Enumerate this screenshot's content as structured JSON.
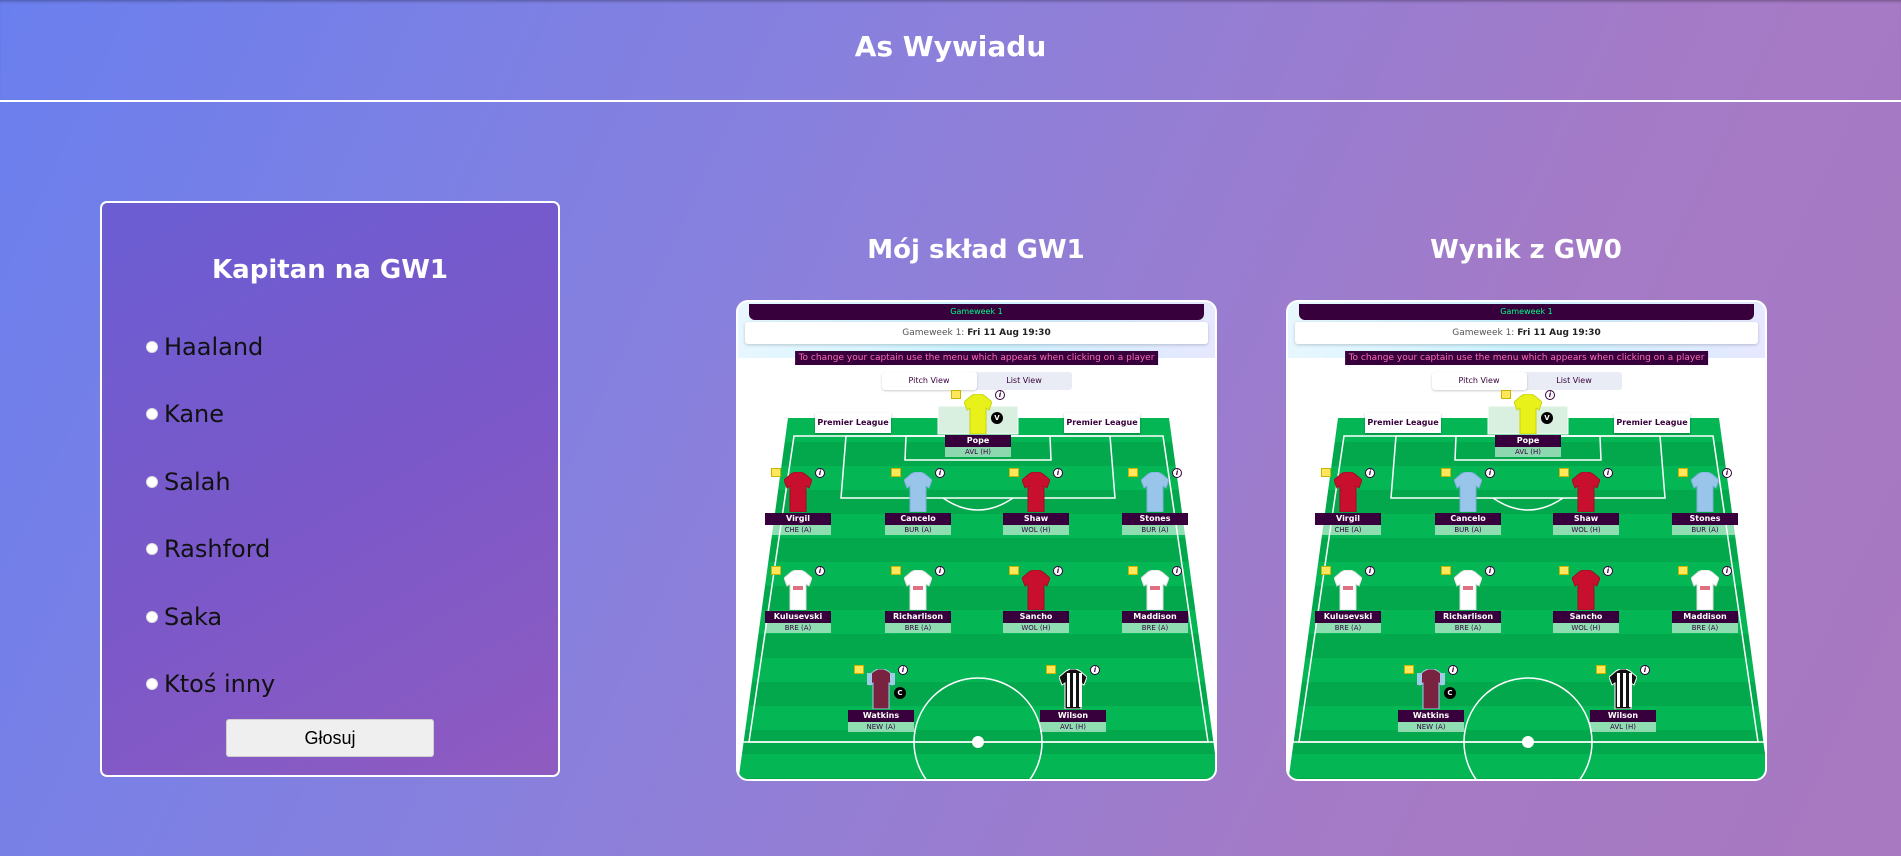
{
  "site": {
    "title": "As Wywiadu"
  },
  "poll": {
    "title": "Kapitan na GW1",
    "options": [
      {
        "label": "Haaland"
      },
      {
        "label": "Kane"
      },
      {
        "label": "Salah"
      },
      {
        "label": "Rashford"
      },
      {
        "label": "Saka"
      },
      {
        "label": "Ktoś inny"
      }
    ],
    "submit_label": "Głosuj"
  },
  "sections": {
    "my_team_title": "Mój skład GW1",
    "result_title": "Wynik z GW0"
  },
  "pitch": {
    "gameweek_label": "Gameweek 1",
    "deadline_prefix": "Gameweek 1:",
    "deadline_value": "Fri 11 Aug 19:30",
    "captain_hint": "To change your captain use the menu which appears when clicking on a player",
    "tab_pitch": "Pitch View",
    "tab_list": "List View",
    "board_text": "Premier League",
    "players": [
      {
        "name": "Pope",
        "fixture": "AVL (H)",
        "kit": "gk",
        "badge": "V"
      },
      {
        "name": "Virgil",
        "fixture": "CHE (A)",
        "kit": "red",
        "badge": ""
      },
      {
        "name": "Cancelo",
        "fixture": "BUR (A)",
        "kit": "sky",
        "badge": ""
      },
      {
        "name": "Shaw",
        "fixture": "WOL (H)",
        "kit": "red",
        "badge": ""
      },
      {
        "name": "Stones",
        "fixture": "BUR (A)",
        "kit": "sky",
        "badge": ""
      },
      {
        "name": "Kulusevski",
        "fixture": "BRE (A)",
        "kit": "white",
        "badge": ""
      },
      {
        "name": "Richarlison",
        "fixture": "BRE (A)",
        "kit": "white",
        "badge": ""
      },
      {
        "name": "Sancho",
        "fixture": "WOL (H)",
        "kit": "red",
        "badge": ""
      },
      {
        "name": "Maddison",
        "fixture": "BRE (A)",
        "kit": "white",
        "badge": ""
      },
      {
        "name": "Watkins",
        "fixture": "NEW (A)",
        "kit": "claret",
        "badge": "C"
      },
      {
        "name": "Wilson",
        "fixture": "AVL (H)",
        "kit": "stripes",
        "badge": ""
      }
    ]
  },
  "colors": {
    "pitch_light": "#05b655",
    "pitch_dark": "#03a84d",
    "fpl_purple": "#37003c",
    "fpl_green": "#00ff87"
  }
}
